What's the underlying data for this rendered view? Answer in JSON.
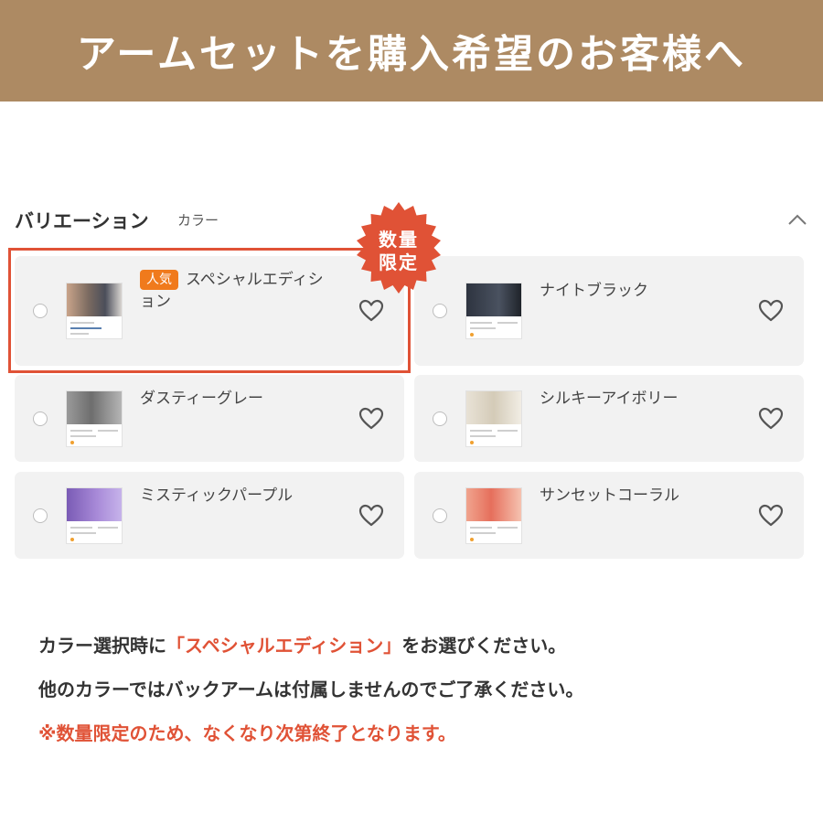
{
  "banner": {
    "title": "アームセットを購入希望のお客様へ"
  },
  "variation": {
    "title": "バリエーション",
    "subtitle": "カラー",
    "items": [
      {
        "name_line1": "スペシャルエディシ",
        "name_line2": "ョン",
        "tag": "人気",
        "selected": true
      },
      {
        "name": "ナイトブラック"
      },
      {
        "name": "ダスティーグレー"
      },
      {
        "name": "シルキーアイボリー"
      },
      {
        "name": "ミスティックパープル"
      },
      {
        "name": "サンセットコーラル"
      }
    ],
    "badge": {
      "line1": "数量",
      "line2": "限定"
    }
  },
  "notes": {
    "line1_before": "カラー選択時に",
    "line1_highlight": "「スペシャルエディション」",
    "line1_after": "をお選びください。",
    "line2": "他のカラーではバックアームは付属しませんのでご了承ください。",
    "line3": "※数量限定のため、なくなり次第終了となります。"
  },
  "colors": {
    "banner": "#ad8a63",
    "accent_red": "#e05236",
    "tag_orange": "#f07a1c",
    "card_bg": "#f2f2f2"
  }
}
